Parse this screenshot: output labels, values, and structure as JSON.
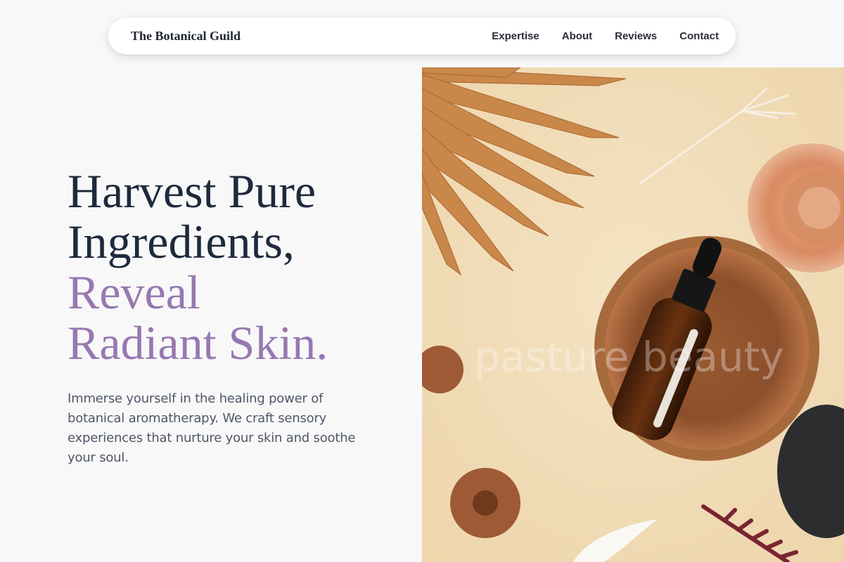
{
  "nav": {
    "brand": "The Botanical Guild",
    "links": [
      "Expertise",
      "About",
      "Reviews",
      "Contact"
    ]
  },
  "hero": {
    "headline_line1": "Harvest Pure",
    "headline_line2": "Ingredients,",
    "headline_line3": "Reveal",
    "headline_line4": "Radiant Skin.",
    "description": "Immerse yourself in the healing power of botanical aromatherapy. We craft sensory experiences that nurture your skin and soothe your soul."
  },
  "image": {
    "watermark": "pasture beauty"
  },
  "colors": {
    "background": "#f8f8f9",
    "heading": "#1e2a3c",
    "accent": "#9778b0",
    "body_text": "#4f5766",
    "image_background": "#f1ddba"
  }
}
